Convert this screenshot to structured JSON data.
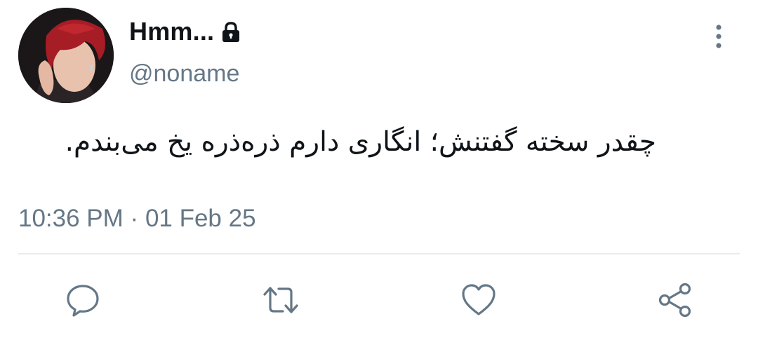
{
  "tweet": {
    "display_name": "Hmm...",
    "handle": "@noname",
    "text": "چقدر سخته گفتنش؛ انگاری دارم ذره‌ذره یخ می‌بندم.",
    "time": "10:36 PM",
    "separator": "·",
    "date": "01 Feb 25"
  },
  "icons": {
    "lock": "lock-icon",
    "more": "more-vertical-icon",
    "reply": "reply-icon",
    "retweet": "retweet-icon",
    "like": "heart-icon",
    "share": "share-icon"
  },
  "colors": {
    "text_primary": "#0f1419",
    "text_secondary": "#657786",
    "divider": "#e6ecf0",
    "icon": "#657786"
  }
}
